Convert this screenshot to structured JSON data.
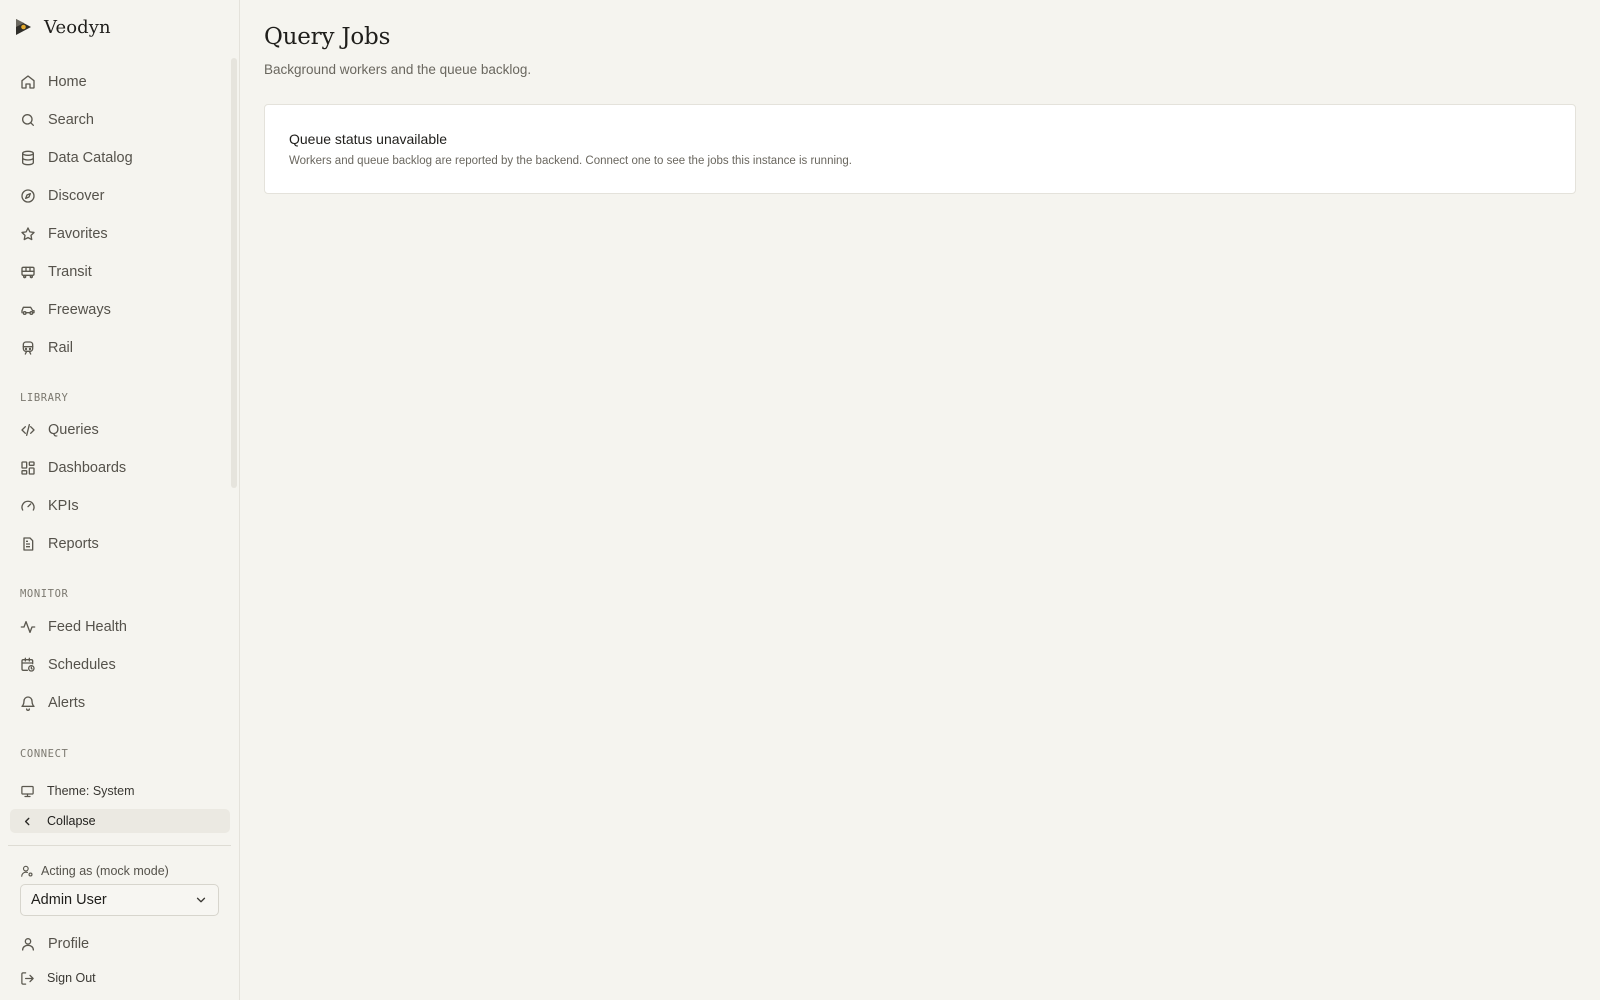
{
  "brand": {
    "name": "Veodyn"
  },
  "sidebar": {
    "primary": [
      {
        "label": "Home",
        "icon": "home-icon"
      },
      {
        "label": "Search",
        "icon": "search-icon"
      },
      {
        "label": "Data Catalog",
        "icon": "database-icon"
      },
      {
        "label": "Discover",
        "icon": "compass-icon"
      },
      {
        "label": "Favorites",
        "icon": "star-icon"
      },
      {
        "label": "Transit",
        "icon": "bus-icon"
      },
      {
        "label": "Freeways",
        "icon": "car-icon"
      },
      {
        "label": "Rail",
        "icon": "train-icon"
      }
    ],
    "library_label": "LIBRARY",
    "library": [
      {
        "label": "Queries",
        "icon": "code-icon"
      },
      {
        "label": "Dashboards",
        "icon": "dashboard-icon"
      },
      {
        "label": "KPIs",
        "icon": "gauge-icon"
      },
      {
        "label": "Reports",
        "icon": "file-text-icon"
      }
    ],
    "monitor_label": "MONITOR",
    "monitor": [
      {
        "label": "Feed Health",
        "icon": "activity-icon"
      },
      {
        "label": "Schedules",
        "icon": "calendar-clock-icon"
      },
      {
        "label": "Alerts",
        "icon": "bell-icon"
      }
    ],
    "connect_label": "CONNECT",
    "theme_label": "Theme: System",
    "collapse_label": "Collapse",
    "acting_label": "Acting as (mock mode)",
    "acting_user": "Admin User",
    "profile_label": "Profile",
    "signout_label": "Sign Out"
  },
  "main": {
    "title": "Query Jobs",
    "subtitle": "Background workers and the queue backlog.",
    "card": {
      "title": "Queue status unavailable",
      "text": "Workers and queue backlog are reported by the backend. Connect one to see the jobs this instance is running."
    }
  }
}
